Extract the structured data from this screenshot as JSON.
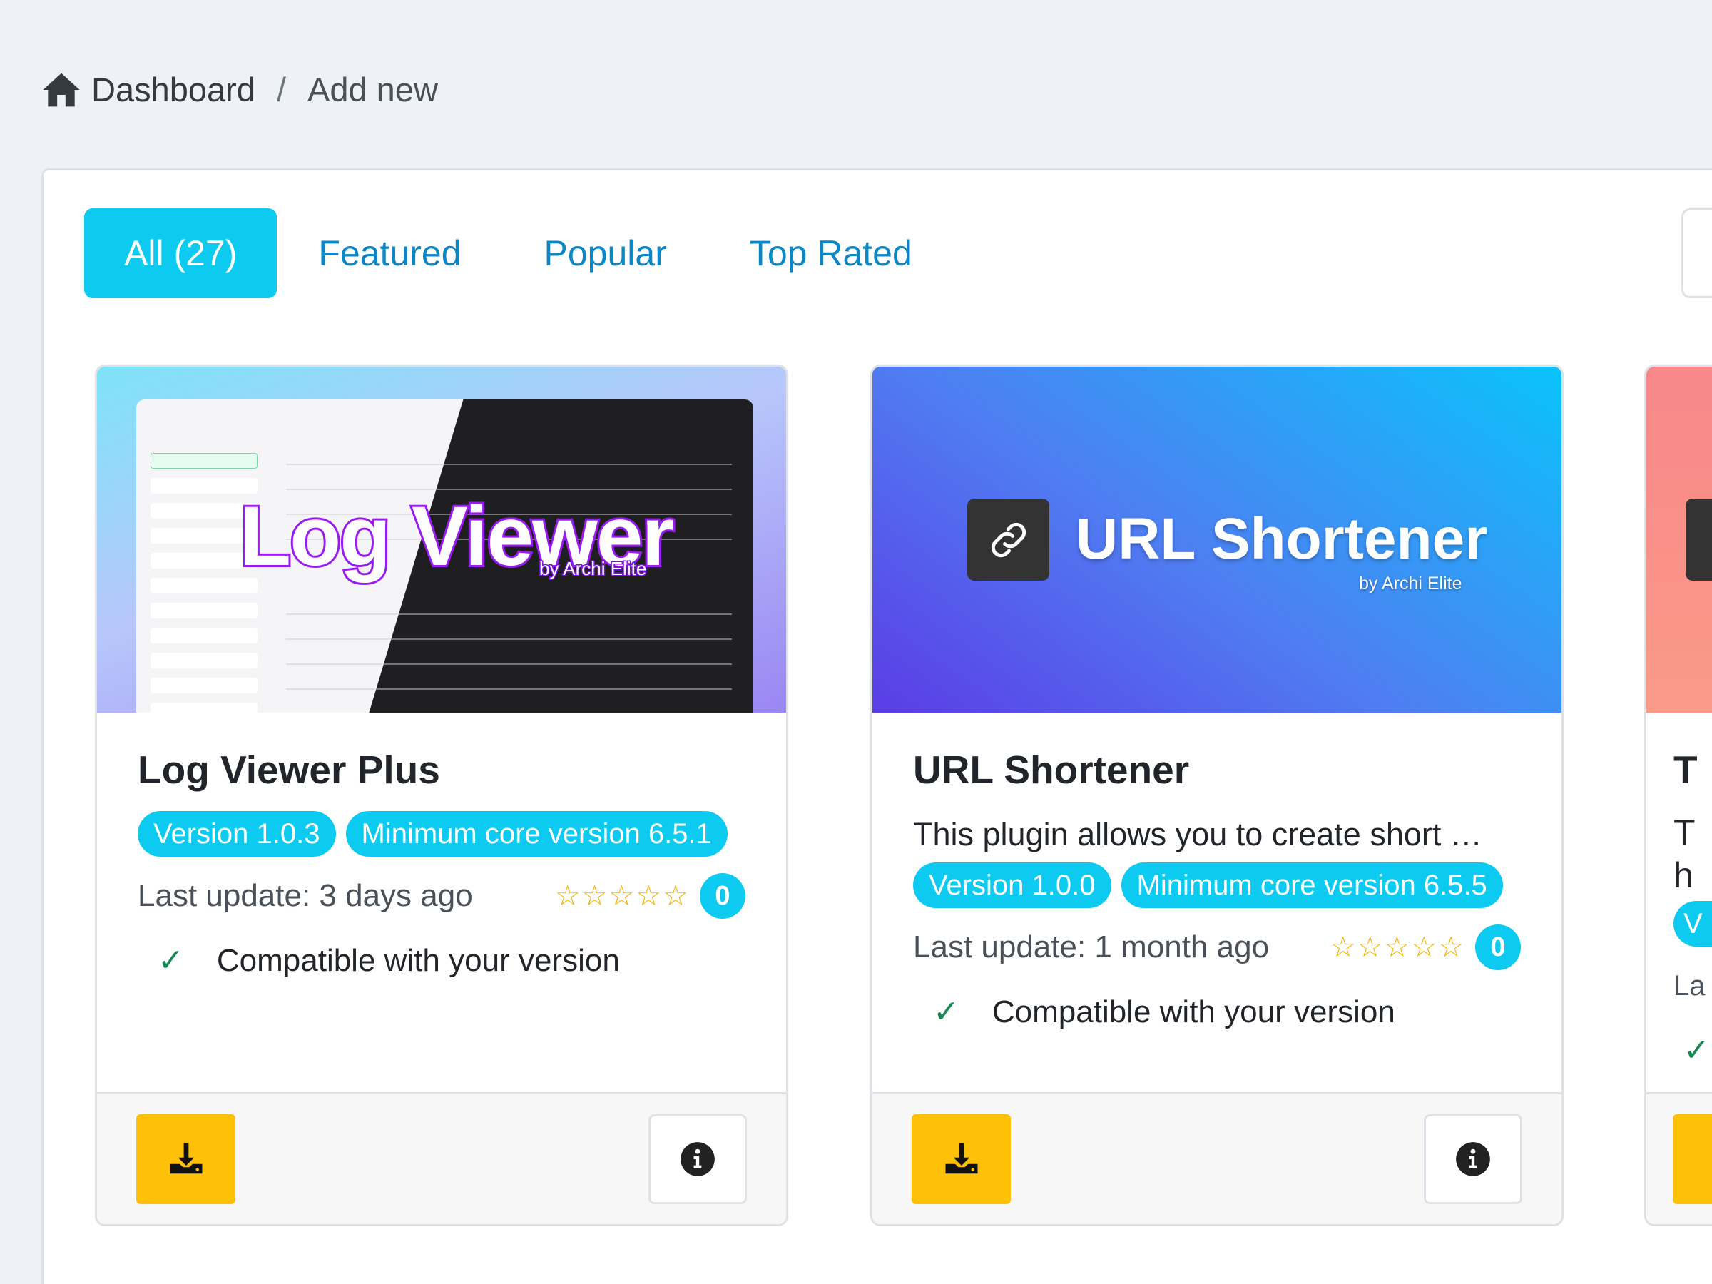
{
  "breadcrumb": {
    "home": "Dashboard",
    "separator": "/",
    "current": "Add new"
  },
  "tabs": [
    {
      "label": "All (27)",
      "active": true
    },
    {
      "label": "Featured"
    },
    {
      "label": "Popular"
    },
    {
      "label": "Top Rated"
    }
  ],
  "colors": {
    "accent": "#0dcaf0",
    "link": "#0b86c6",
    "download": "#ffc107",
    "star": "#f5b400",
    "check": "#198754"
  },
  "plugins": [
    {
      "image_text": "Log Viewer",
      "image_by": "by Archi Elite",
      "title": "Log Viewer Plus",
      "description": "",
      "version": "Version 1.0.3",
      "min_core": "Minimum core version 6.5.1",
      "last_update": "Last update: 3 days ago",
      "rating": 0,
      "rating_count": "0",
      "compat": "Compatible with your version"
    },
    {
      "image_text": "URL Shortener",
      "image_by": "by Archi Elite",
      "title": "URL Shortener",
      "description": "This plugin allows you to create short …",
      "version": "Version 1.0.0",
      "min_core": "Minimum core version 6.5.5",
      "last_update": "Last update: 1 month ago",
      "rating": 0,
      "rating_count": "0",
      "compat": "Compatible with your version"
    },
    {
      "title": "T",
      "description": "Th",
      "version": "V",
      "last_update": "La"
    }
  ],
  "icons": {
    "home": "home-icon",
    "download": "download-icon",
    "info": "info-circle-icon",
    "check": "check-icon",
    "star": "star-outline-icon",
    "link": "link-icon"
  }
}
